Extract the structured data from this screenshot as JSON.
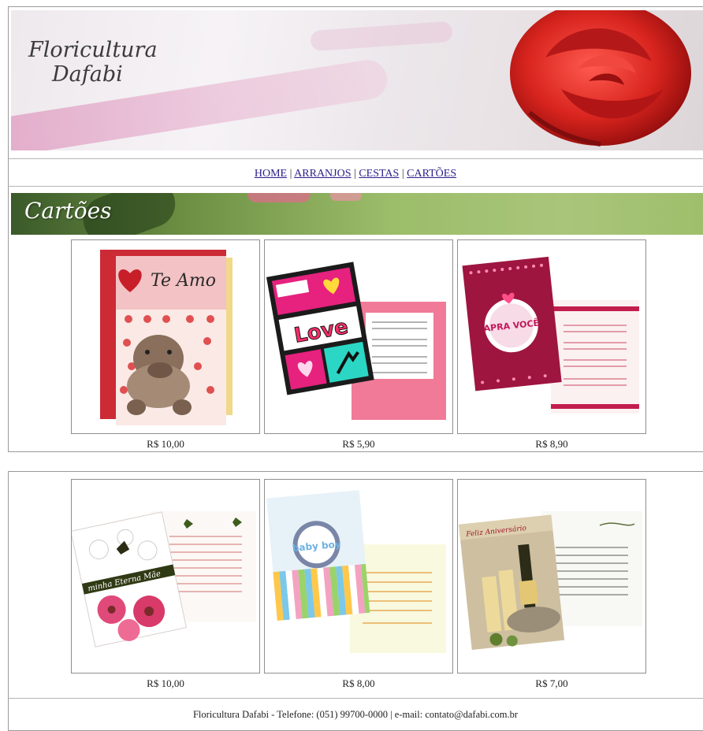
{
  "header": {
    "logo_line1": "Floricultura",
    "logo_line2": "Dafabi"
  },
  "nav": {
    "items": [
      {
        "label": "HOME"
      },
      {
        "label": "ARRANJOS"
      },
      {
        "label": "CESTAS"
      },
      {
        "label": "CARTÕES"
      }
    ],
    "separator": "|"
  },
  "section": {
    "title": "Cartões"
  },
  "products": [
    {
      "price": "R$ 10,00",
      "card_text": "Te Amo"
    },
    {
      "price": "R$ 5,90",
      "card_text": "Love"
    },
    {
      "price": "R$ 8,90",
      "card_text": "APRA VOCÊ"
    },
    {
      "price": "R$ 10,00",
      "card_text": "minha Eterna Mãe"
    },
    {
      "price": "R$ 8,00",
      "card_text": "baby boy"
    },
    {
      "price": "R$ 7,00",
      "card_text": "Feliz Aniversário"
    }
  ],
  "footer": {
    "text": "Floricultura Dafabi - Telefone: (051) 99700-0000 | e-mail: contato@dafabi.com.br"
  },
  "colors": {
    "link": "#2a1d8a",
    "border": "#9a9a9a",
    "banner_green": "#9cbd6a",
    "rose_red": "#d42a2a"
  }
}
